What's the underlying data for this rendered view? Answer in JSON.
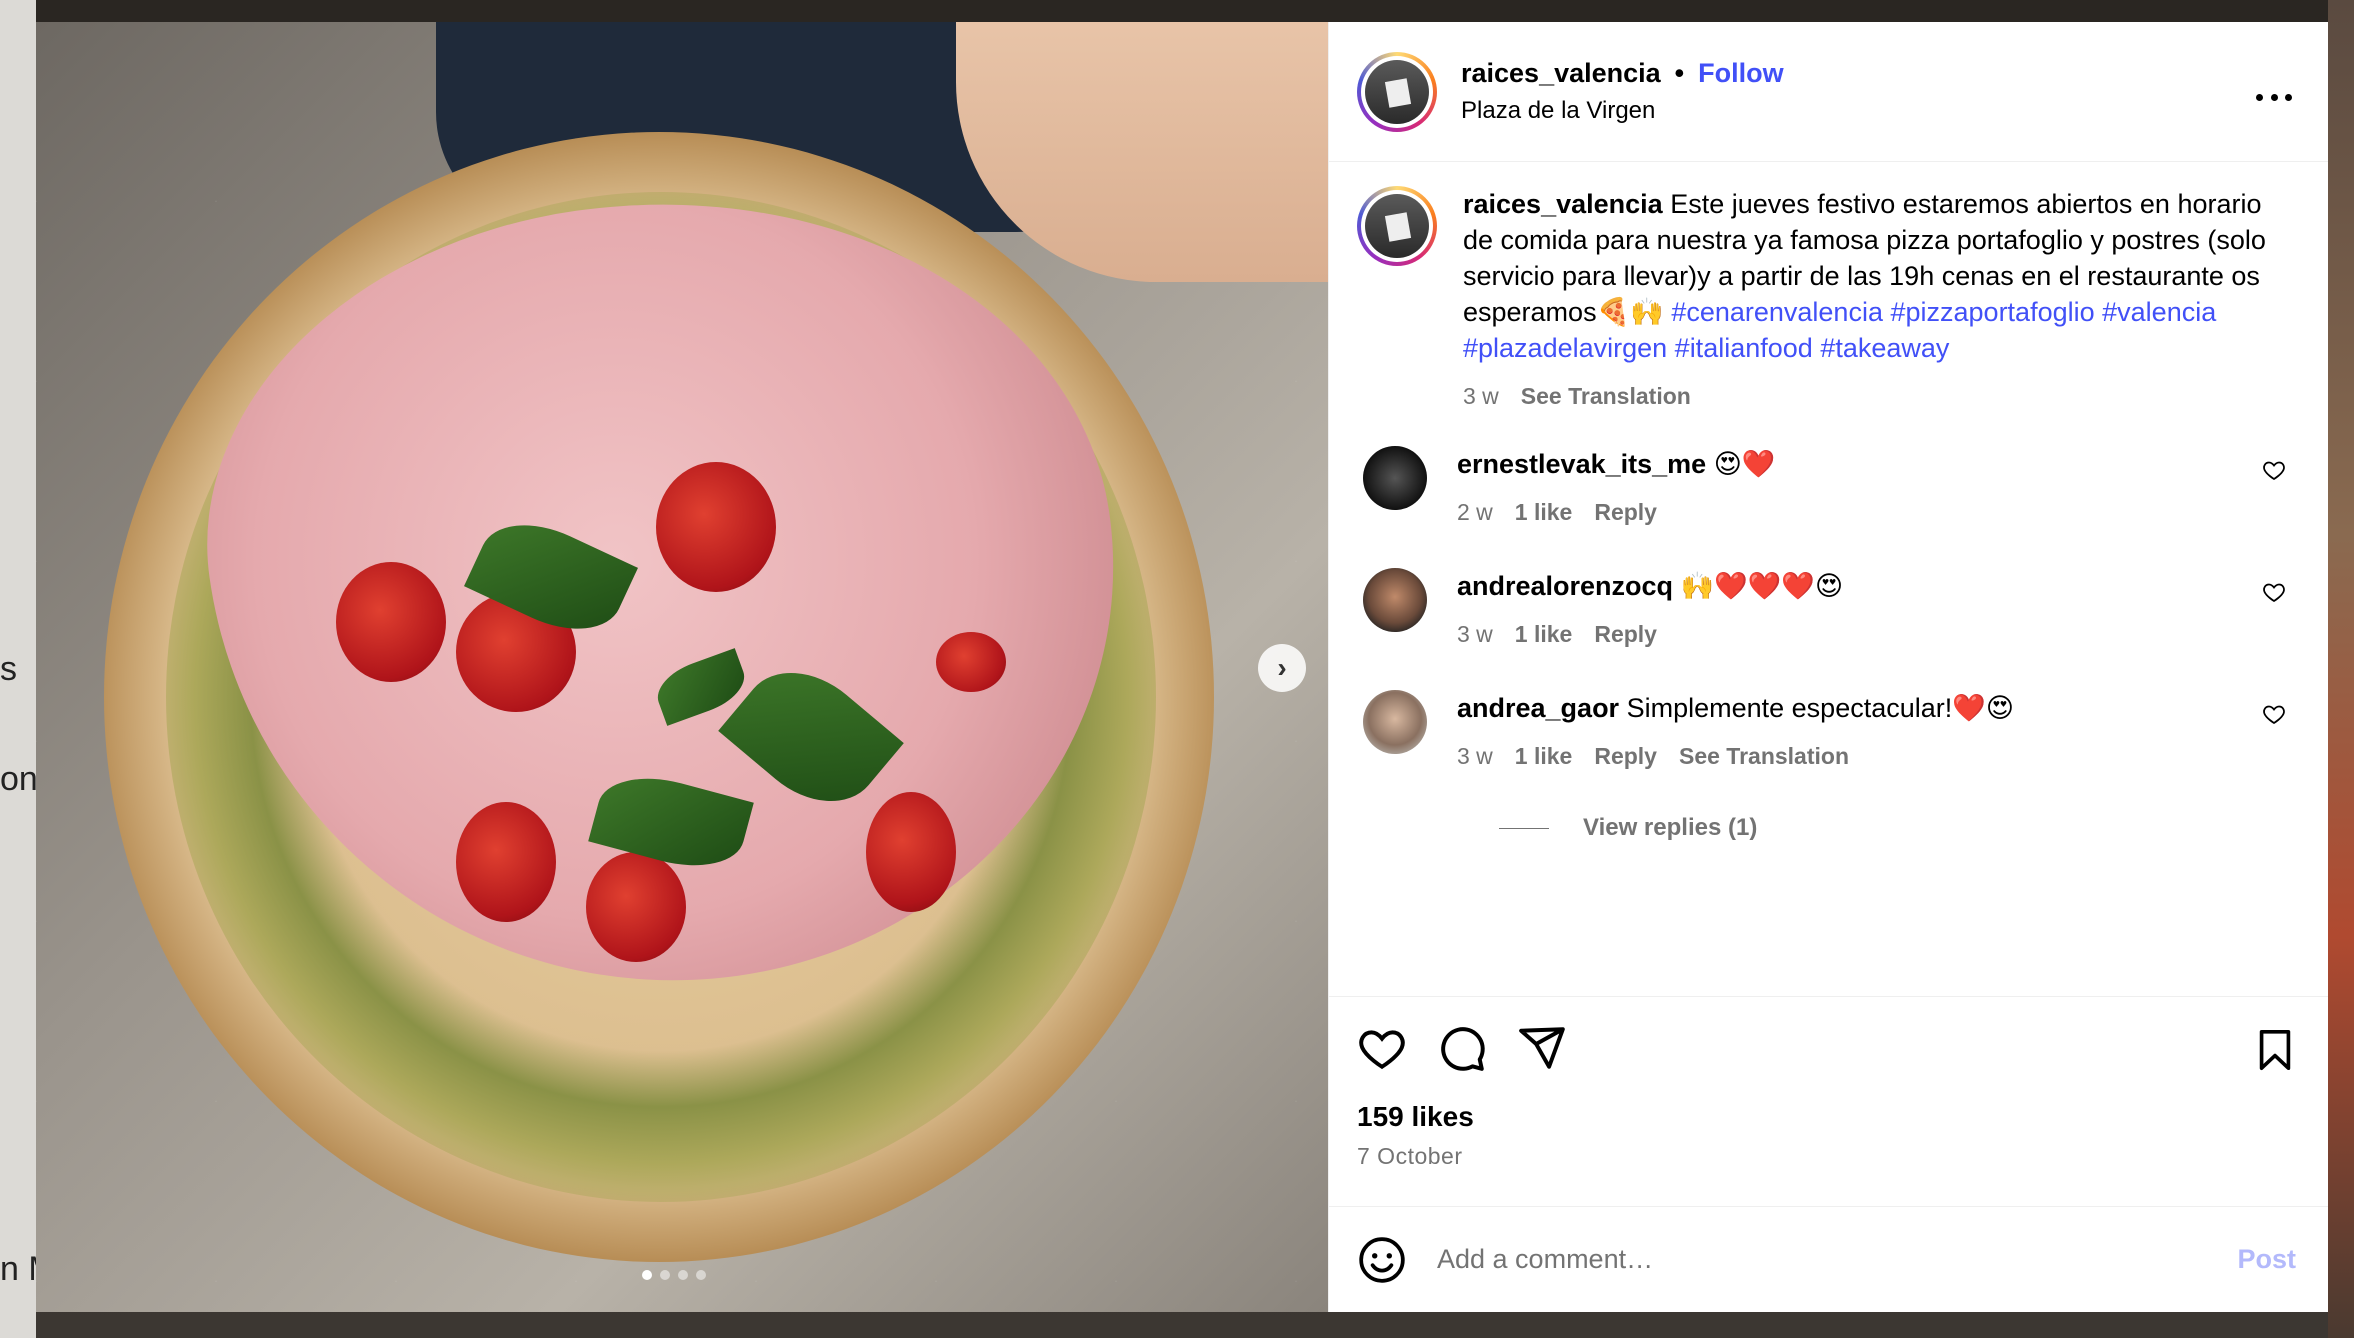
{
  "background": {
    "left_fragments": [
      "s",
      "on",
      "n M"
    ]
  },
  "post": {
    "username": "raices_valencia",
    "separator": "•",
    "follow_label": "Follow",
    "location": "Plaza de la Virgen",
    "image_alt": "pizza portafoglio with mortadella, pistachio, tomatoes and basil",
    "carousel_count": 4,
    "carousel_active": 0
  },
  "caption": {
    "username": "raices_valencia",
    "text": "Este jueves festivo estaremos abiertos en horario de comida para nuestra ya famosa pizza portafoglio y postres (solo servicio para llevar)y a partir de las 19h cenas en el restaurante os esperamos🍕🙌 ",
    "hashtags": [
      "#cenarenvalencia",
      "#pizzaportafoglio",
      "#valencia",
      "#plazadelavirgen",
      "#italianfood",
      "#takeaway"
    ],
    "age": "3 w",
    "translate_label": "See Translation"
  },
  "comments": [
    {
      "username": "ernestlevak_its_me",
      "text": "😍❤️",
      "age": "2 w",
      "likes": "1 like",
      "reply_label": "Reply",
      "translate_label": ""
    },
    {
      "username": "andrealorenzocq",
      "text": "🙌❤️❤️❤️😍",
      "age": "3 w",
      "likes": "1 like",
      "reply_label": "Reply",
      "translate_label": ""
    },
    {
      "username": "andrea_gaor",
      "text": "Simplemente espectacular!❤️😍",
      "age": "3 w",
      "likes": "1 like",
      "reply_label": "Reply",
      "translate_label": "See Translation"
    }
  ],
  "view_replies_label": "View replies (1)",
  "engagement": {
    "likes": "159 likes",
    "date": "7 October"
  },
  "composer": {
    "placeholder": "Add a comment…",
    "post_label": "Post"
  },
  "colors": {
    "link": "#4150f7",
    "muted": "#737373",
    "post_disabled": "#b3b9fb"
  },
  "icons": [
    "heart-icon",
    "comment-icon",
    "share-icon",
    "bookmark-icon",
    "more-icon",
    "emoji-icon",
    "chevron-right-icon"
  ]
}
